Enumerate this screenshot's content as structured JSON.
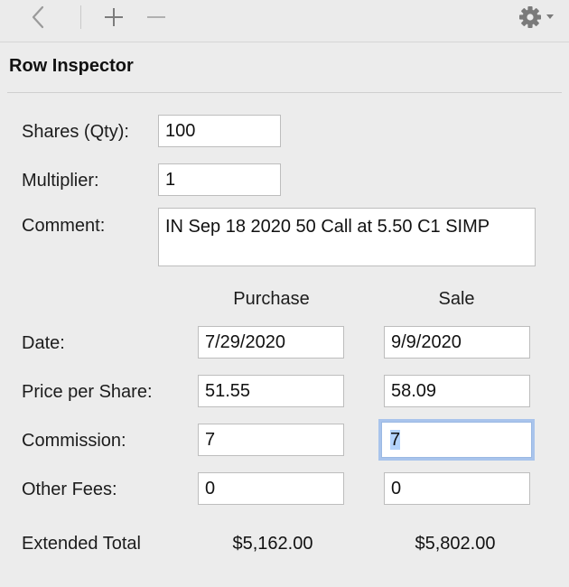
{
  "toolbar": {
    "back_icon": "chevron-left-icon",
    "add_icon": "plus-icon",
    "remove_icon": "minus-icon",
    "gear_icon": "gear-icon"
  },
  "panel": {
    "title": "Row Inspector"
  },
  "fields": {
    "shares": {
      "label": "Shares (Qty):",
      "value": "100"
    },
    "multiplier": {
      "label": "Multiplier:",
      "value": "1"
    },
    "comment": {
      "label": "Comment:",
      "value": "IN Sep 18 2020 50 Call at 5.50 C1 SIMP"
    }
  },
  "columns": {
    "purchase": "Purchase",
    "sale": "Sale"
  },
  "rows": {
    "date": {
      "label": "Date:",
      "purchase": "7/29/2020",
      "sale": "9/9/2020"
    },
    "price": {
      "label": "Price per Share:",
      "purchase": "51.55",
      "sale": "58.09"
    },
    "commission": {
      "label": "Commission:",
      "purchase": "7",
      "sale": "7"
    },
    "fees": {
      "label": "Other Fees:",
      "purchase": "0",
      "sale": "0"
    }
  },
  "totals": {
    "label": "Extended Total",
    "purchase": "$5,162.00",
    "sale": "$5,802.00"
  },
  "colors": {
    "focus_ring": "#a9c4ec",
    "selection": "#b3d3fb",
    "toolbar_icon": "#8a8a8a"
  }
}
